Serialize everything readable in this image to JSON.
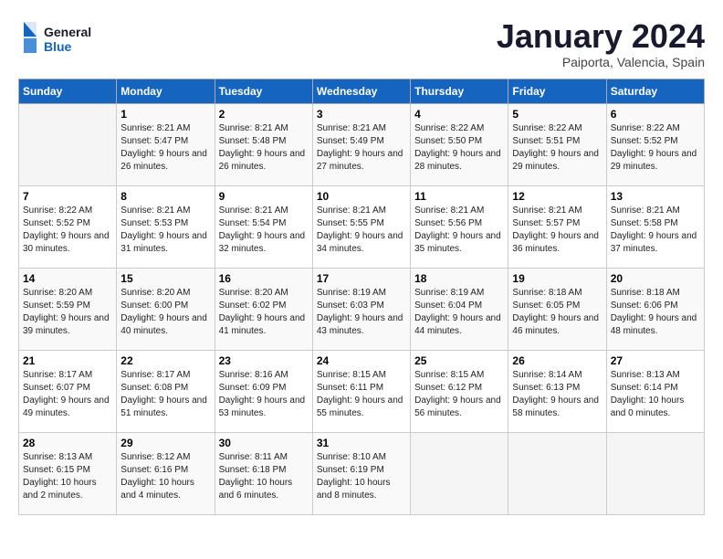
{
  "header": {
    "logo_general": "General",
    "logo_blue": "Blue",
    "month": "January 2024",
    "location": "Paiporta, Valencia, Spain"
  },
  "days_of_week": [
    "Sunday",
    "Monday",
    "Tuesday",
    "Wednesday",
    "Thursday",
    "Friday",
    "Saturday"
  ],
  "weeks": [
    [
      {
        "day": "",
        "sunrise": "",
        "sunset": "",
        "daylight": ""
      },
      {
        "day": "1",
        "sunrise": "Sunrise: 8:21 AM",
        "sunset": "Sunset: 5:47 PM",
        "daylight": "Daylight: 9 hours and 26 minutes."
      },
      {
        "day": "2",
        "sunrise": "Sunrise: 8:21 AM",
        "sunset": "Sunset: 5:48 PM",
        "daylight": "Daylight: 9 hours and 26 minutes."
      },
      {
        "day": "3",
        "sunrise": "Sunrise: 8:21 AM",
        "sunset": "Sunset: 5:49 PM",
        "daylight": "Daylight: 9 hours and 27 minutes."
      },
      {
        "day": "4",
        "sunrise": "Sunrise: 8:22 AM",
        "sunset": "Sunset: 5:50 PM",
        "daylight": "Daylight: 9 hours and 28 minutes."
      },
      {
        "day": "5",
        "sunrise": "Sunrise: 8:22 AM",
        "sunset": "Sunset: 5:51 PM",
        "daylight": "Daylight: 9 hours and 29 minutes."
      },
      {
        "day": "6",
        "sunrise": "Sunrise: 8:22 AM",
        "sunset": "Sunset: 5:52 PM",
        "daylight": "Daylight: 9 hours and 29 minutes."
      }
    ],
    [
      {
        "day": "7",
        "sunrise": "Sunrise: 8:22 AM",
        "sunset": "Sunset: 5:52 PM",
        "daylight": "Daylight: 9 hours and 30 minutes."
      },
      {
        "day": "8",
        "sunrise": "Sunrise: 8:21 AM",
        "sunset": "Sunset: 5:53 PM",
        "daylight": "Daylight: 9 hours and 31 minutes."
      },
      {
        "day": "9",
        "sunrise": "Sunrise: 8:21 AM",
        "sunset": "Sunset: 5:54 PM",
        "daylight": "Daylight: 9 hours and 32 minutes."
      },
      {
        "day": "10",
        "sunrise": "Sunrise: 8:21 AM",
        "sunset": "Sunset: 5:55 PM",
        "daylight": "Daylight: 9 hours and 34 minutes."
      },
      {
        "day": "11",
        "sunrise": "Sunrise: 8:21 AM",
        "sunset": "Sunset: 5:56 PM",
        "daylight": "Daylight: 9 hours and 35 minutes."
      },
      {
        "day": "12",
        "sunrise": "Sunrise: 8:21 AM",
        "sunset": "Sunset: 5:57 PM",
        "daylight": "Daylight: 9 hours and 36 minutes."
      },
      {
        "day": "13",
        "sunrise": "Sunrise: 8:21 AM",
        "sunset": "Sunset: 5:58 PM",
        "daylight": "Daylight: 9 hours and 37 minutes."
      }
    ],
    [
      {
        "day": "14",
        "sunrise": "Sunrise: 8:20 AM",
        "sunset": "Sunset: 5:59 PM",
        "daylight": "Daylight: 9 hours and 39 minutes."
      },
      {
        "day": "15",
        "sunrise": "Sunrise: 8:20 AM",
        "sunset": "Sunset: 6:00 PM",
        "daylight": "Daylight: 9 hours and 40 minutes."
      },
      {
        "day": "16",
        "sunrise": "Sunrise: 8:20 AM",
        "sunset": "Sunset: 6:02 PM",
        "daylight": "Daylight: 9 hours and 41 minutes."
      },
      {
        "day": "17",
        "sunrise": "Sunrise: 8:19 AM",
        "sunset": "Sunset: 6:03 PM",
        "daylight": "Daylight: 9 hours and 43 minutes."
      },
      {
        "day": "18",
        "sunrise": "Sunrise: 8:19 AM",
        "sunset": "Sunset: 6:04 PM",
        "daylight": "Daylight: 9 hours and 44 minutes."
      },
      {
        "day": "19",
        "sunrise": "Sunrise: 8:18 AM",
        "sunset": "Sunset: 6:05 PM",
        "daylight": "Daylight: 9 hours and 46 minutes."
      },
      {
        "day": "20",
        "sunrise": "Sunrise: 8:18 AM",
        "sunset": "Sunset: 6:06 PM",
        "daylight": "Daylight: 9 hours and 48 minutes."
      }
    ],
    [
      {
        "day": "21",
        "sunrise": "Sunrise: 8:17 AM",
        "sunset": "Sunset: 6:07 PM",
        "daylight": "Daylight: 9 hours and 49 minutes."
      },
      {
        "day": "22",
        "sunrise": "Sunrise: 8:17 AM",
        "sunset": "Sunset: 6:08 PM",
        "daylight": "Daylight: 9 hours and 51 minutes."
      },
      {
        "day": "23",
        "sunrise": "Sunrise: 8:16 AM",
        "sunset": "Sunset: 6:09 PM",
        "daylight": "Daylight: 9 hours and 53 minutes."
      },
      {
        "day": "24",
        "sunrise": "Sunrise: 8:15 AM",
        "sunset": "Sunset: 6:11 PM",
        "daylight": "Daylight: 9 hours and 55 minutes."
      },
      {
        "day": "25",
        "sunrise": "Sunrise: 8:15 AM",
        "sunset": "Sunset: 6:12 PM",
        "daylight": "Daylight: 9 hours and 56 minutes."
      },
      {
        "day": "26",
        "sunrise": "Sunrise: 8:14 AM",
        "sunset": "Sunset: 6:13 PM",
        "daylight": "Daylight: 9 hours and 58 minutes."
      },
      {
        "day": "27",
        "sunrise": "Sunrise: 8:13 AM",
        "sunset": "Sunset: 6:14 PM",
        "daylight": "Daylight: 10 hours and 0 minutes."
      }
    ],
    [
      {
        "day": "28",
        "sunrise": "Sunrise: 8:13 AM",
        "sunset": "Sunset: 6:15 PM",
        "daylight": "Daylight: 10 hours and 2 minutes."
      },
      {
        "day": "29",
        "sunrise": "Sunrise: 8:12 AM",
        "sunset": "Sunset: 6:16 PM",
        "daylight": "Daylight: 10 hours and 4 minutes."
      },
      {
        "day": "30",
        "sunrise": "Sunrise: 8:11 AM",
        "sunset": "Sunset: 6:18 PM",
        "daylight": "Daylight: 10 hours and 6 minutes."
      },
      {
        "day": "31",
        "sunrise": "Sunrise: 8:10 AM",
        "sunset": "Sunset: 6:19 PM",
        "daylight": "Daylight: 10 hours and 8 minutes."
      },
      {
        "day": "",
        "sunrise": "",
        "sunset": "",
        "daylight": ""
      },
      {
        "day": "",
        "sunrise": "",
        "sunset": "",
        "daylight": ""
      },
      {
        "day": "",
        "sunrise": "",
        "sunset": "",
        "daylight": ""
      }
    ]
  ]
}
